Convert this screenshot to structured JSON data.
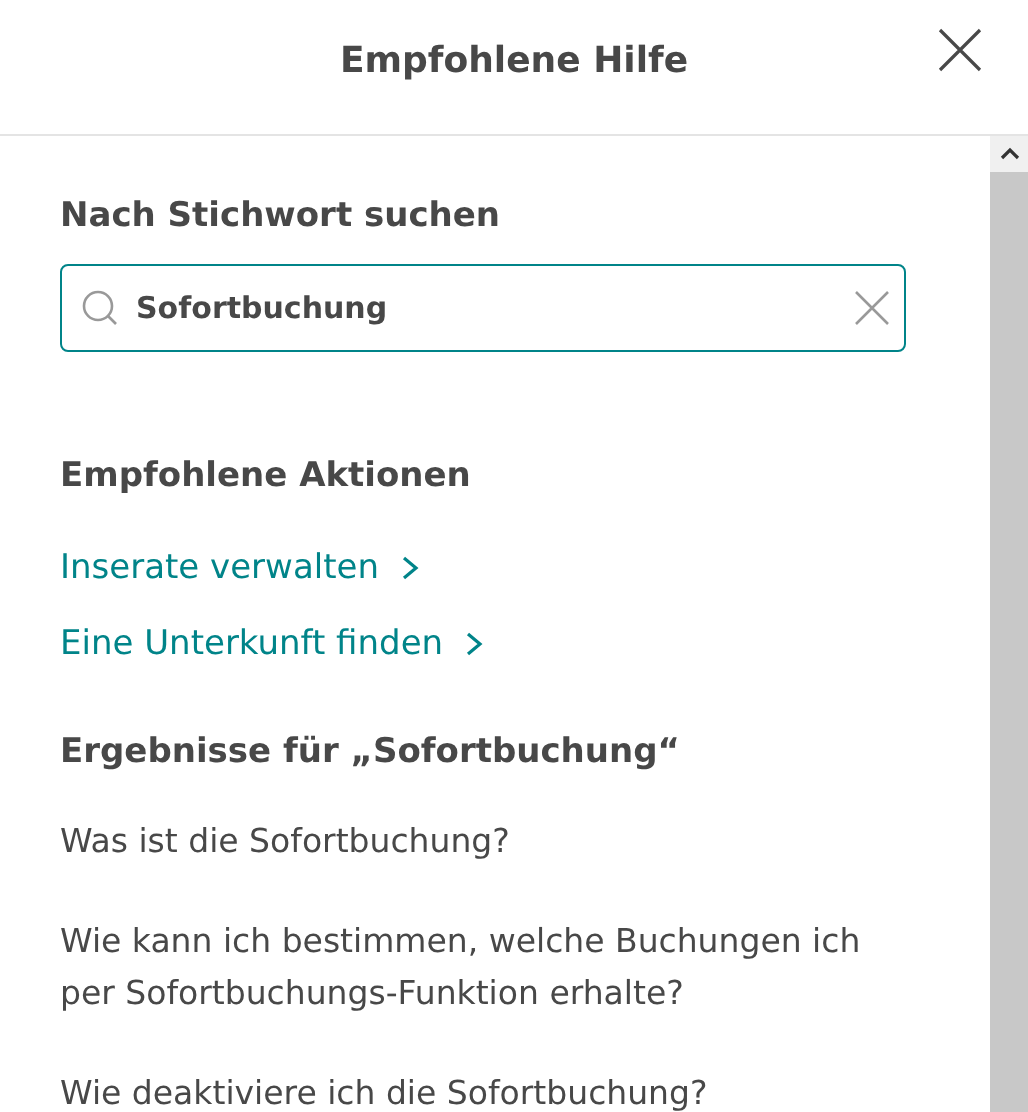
{
  "header": {
    "title": "Empfohlene Hilfe"
  },
  "search": {
    "label": "Nach Stichwort suchen",
    "value": "Sofortbuchung"
  },
  "actions": {
    "heading": "Empfohlene Aktionen",
    "links": [
      "Inserate verwalten",
      "Eine Unterkunft finden"
    ]
  },
  "results": {
    "heading": "Ergebnisse für „Sofortbuchung“",
    "items": [
      "Was ist die Sofortbuchung?",
      "Wie kann ich bestimmen, welche Buchungen ich per Sofortbuchungs-Funktion erhalte?",
      "Wie deaktiviere ich die Sofortbuchung?"
    ]
  }
}
